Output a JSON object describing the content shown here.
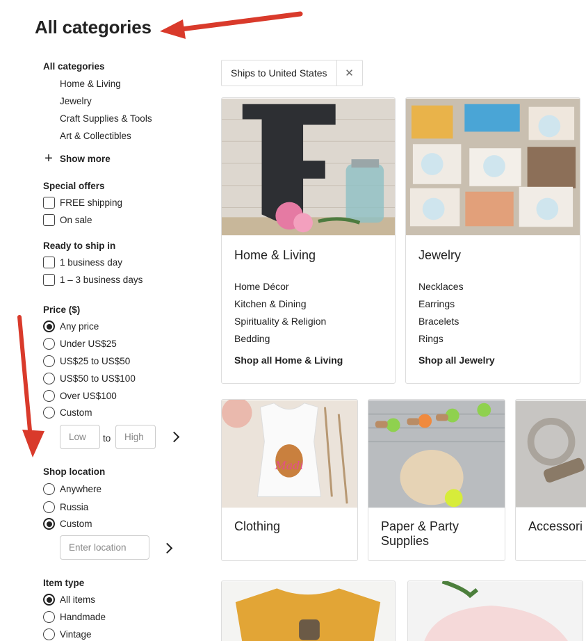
{
  "page": {
    "title": "All categories"
  },
  "sidebar": {
    "categories": {
      "heading": "All categories",
      "items": [
        "Home & Living",
        "Jewelry",
        "Craft Supplies & Tools",
        "Art & Collectibles"
      ],
      "show_more": "Show more"
    },
    "special_offers": {
      "heading": "Special offers",
      "options": [
        "FREE shipping",
        "On sale"
      ]
    },
    "ready_to_ship": {
      "heading": "Ready to ship in",
      "options": [
        "1 business day",
        "1 – 3 business days"
      ]
    },
    "price": {
      "heading": "Price ($)",
      "options": [
        "Any price",
        "Under US$25",
        "US$25 to US$50",
        "US$50 to US$100",
        "Over US$100",
        "Custom"
      ],
      "selected": "Any price",
      "low_placeholder": "Low",
      "to_label": "to",
      "high_placeholder": "High"
    },
    "shop_location": {
      "heading": "Shop location",
      "options": [
        "Anywhere",
        "Russia",
        "Custom"
      ],
      "selected": "Custom",
      "location_placeholder": "Enter location"
    },
    "item_type": {
      "heading": "Item type",
      "options": [
        "All items",
        "Handmade",
        "Vintage"
      ],
      "selected": "All items"
    }
  },
  "filter_chip": {
    "label": "Ships to United States"
  },
  "cards": [
    {
      "title": "Home & Living",
      "links": [
        "Home Décor",
        "Kitchen & Dining",
        "Spirituality & Religion",
        "Bedding"
      ],
      "shop_all": "Shop all Home & Living"
    },
    {
      "title": "Jewelry",
      "links": [
        "Necklaces",
        "Earrings",
        "Bracelets",
        "Rings"
      ],
      "shop_all": "Shop all Jewelry"
    },
    {
      "title": "Clothing"
    },
    {
      "title": "Paper & Party Supplies"
    },
    {
      "title": "Accessori"
    }
  ],
  "colors": {
    "arrow": "#d93a2b",
    "text": "#222222",
    "border": "#dddddd"
  }
}
